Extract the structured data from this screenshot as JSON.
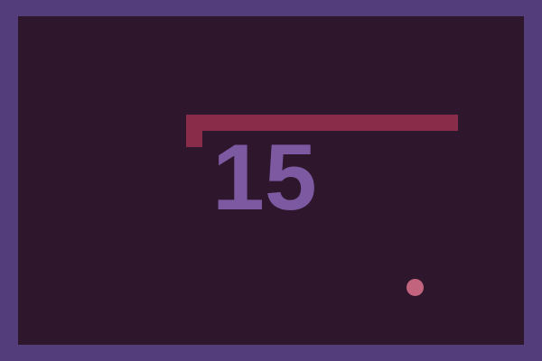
{
  "game": {
    "score": "15"
  },
  "colors": {
    "border": "#533d7a",
    "field": "#2e162d",
    "score": "#7c59a0",
    "paddle": "#892c4a",
    "ball": "#c2647d"
  }
}
